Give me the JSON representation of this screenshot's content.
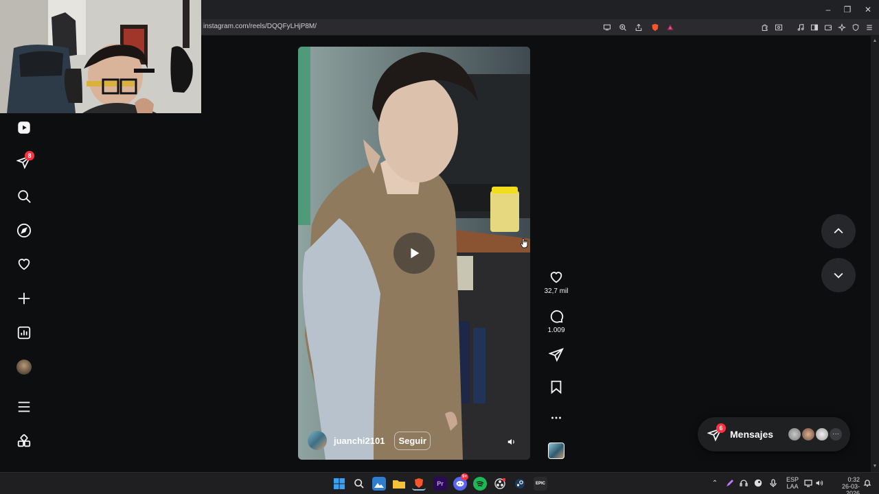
{
  "browser": {
    "url": "instagram.com/reels/DQQFyLHjP8M/",
    "window_controls": {
      "minimize": "–",
      "restore": "❐",
      "close": "✕"
    }
  },
  "sidebar": {
    "items": [
      {
        "name": "reels",
        "icon": "reels-icon"
      },
      {
        "name": "messages",
        "icon": "send-icon",
        "badge": "8"
      },
      {
        "name": "search",
        "icon": "search-icon"
      },
      {
        "name": "explore",
        "icon": "compass-icon"
      },
      {
        "name": "notifications",
        "icon": "heart-icon"
      },
      {
        "name": "create",
        "icon": "plus-icon"
      },
      {
        "name": "dashboard",
        "icon": "chart-icon"
      },
      {
        "name": "profile",
        "icon": "avatar"
      },
      {
        "name": "more",
        "icon": "menu-icon"
      },
      {
        "name": "also-from-meta",
        "icon": "apps-icon"
      }
    ]
  },
  "reel": {
    "author": "juanchi2101",
    "follow_label": "Seguir",
    "likes": "32,7 mil",
    "comments": "1.009"
  },
  "messages": {
    "label": "Mensajes",
    "badge": "6",
    "more": "···"
  },
  "taskbar": {
    "language": "ESP",
    "layout": "LAA",
    "time": "0:32",
    "date": "26-03-2026",
    "discord_badge": "9+",
    "epic_label": "EPIC",
    "premiere_label": "Pr"
  },
  "colors": {
    "page_bg": "#0d0e0f",
    "badge": "#ff3040",
    "sidebar_icon": "#f5f5f5"
  }
}
